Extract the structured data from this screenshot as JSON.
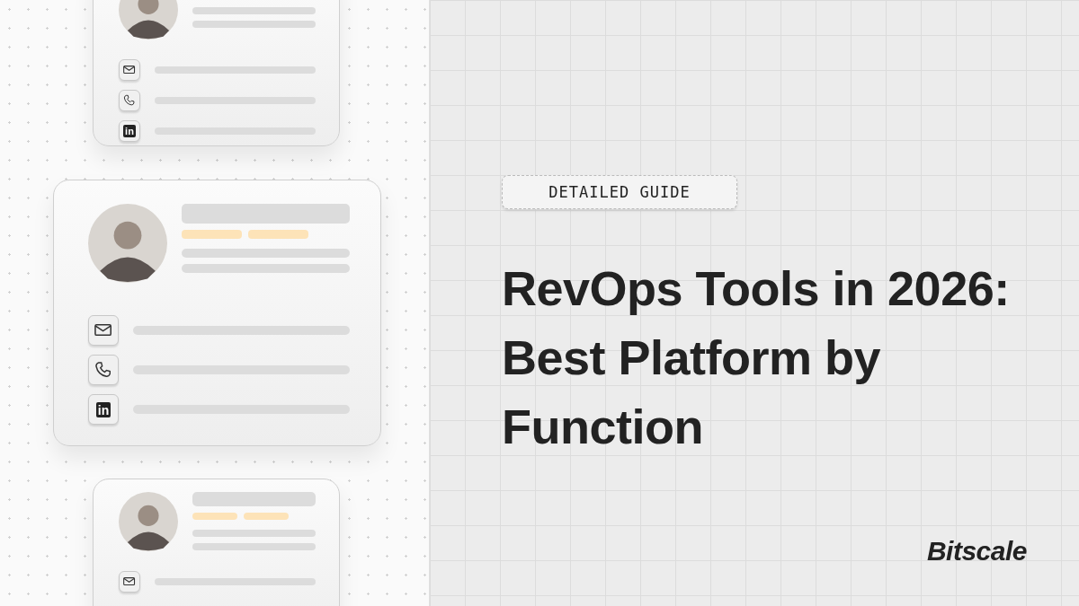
{
  "cards": [
    {
      "kind": "small",
      "has_tags": false,
      "contacts": [
        {
          "kind": "email"
        },
        {
          "kind": "phone"
        },
        {
          "kind": "linkedin",
          "label": "in"
        }
      ]
    },
    {
      "kind": "large",
      "has_tags": true,
      "contacts": [
        {
          "kind": "email"
        },
        {
          "kind": "phone"
        },
        {
          "kind": "linkedin",
          "label": "in"
        }
      ]
    },
    {
      "kind": "small",
      "has_tags": true,
      "contacts": [
        {
          "kind": "email"
        }
      ]
    }
  ],
  "badge": "DETAILED GUIDE",
  "title": "RevOps Tools in 2026: Best Platform by Function",
  "logo": "Bitscale"
}
